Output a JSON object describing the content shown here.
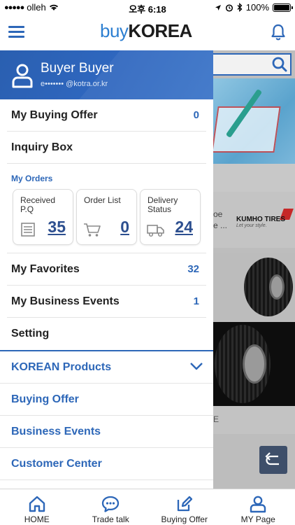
{
  "status_bar": {
    "carrier": "olleh",
    "time": "오후 6:18",
    "battery": "100%"
  },
  "header": {
    "logo_buy": "buy",
    "logo_korea": "KOREA"
  },
  "drawer": {
    "user_name": "Buyer Buyer",
    "user_email": "e••••••• @kotra.or.kr",
    "buying_offer": {
      "label": "My Buying Offer",
      "count": "0"
    },
    "inquiry_box": {
      "label": "Inquiry Box"
    },
    "orders": {
      "title": "My Orders",
      "cards": [
        {
          "label": "Received P.Q",
          "count": "35",
          "icon": "document-icon"
        },
        {
          "label": "Order List",
          "count": "0",
          "icon": "cart-icon"
        },
        {
          "label": "Delivery Status",
          "count": "24",
          "icon": "truck-icon"
        }
      ]
    },
    "favorites": {
      "label": "My Favorites",
      "count": "32"
    },
    "business_events_mine": {
      "label": "My Business Events",
      "count": "1"
    },
    "setting": {
      "label": "Setting"
    },
    "nav": [
      {
        "label": "KOREAN Products",
        "icon": "chevron-down-icon"
      },
      {
        "label": "Buying Offer"
      },
      {
        "label": "Business Events"
      },
      {
        "label": "Customer Center"
      }
    ]
  },
  "background": {
    "card_text_1": "oe",
    "card_text_2": "e ...",
    "brand": "KUMHO TIRES",
    "brand_tagline": "Let your style.",
    "row_text": "E"
  },
  "tabbar": {
    "tabs": [
      {
        "label": "HOME",
        "icon": "home-icon"
      },
      {
        "label": "Trade talk",
        "icon": "chat-icon"
      },
      {
        "label": "Buying Offer",
        "icon": "edit-icon"
      },
      {
        "label": "MY Page",
        "icon": "user-icon"
      }
    ]
  },
  "colors": {
    "primary": "#2d67b8",
    "profile_bg": "#2f67bf",
    "overlay": "#bdbdbd"
  }
}
